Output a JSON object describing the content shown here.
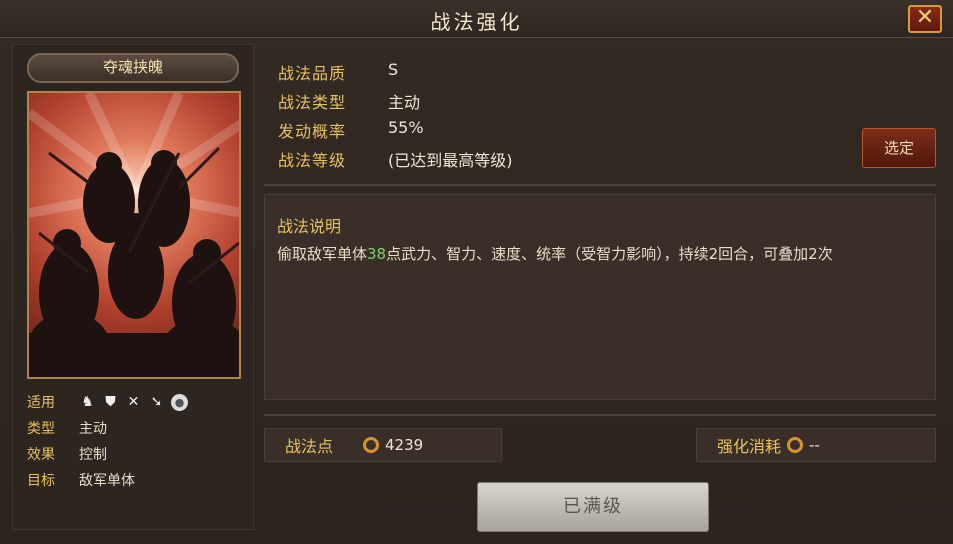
{
  "header": {
    "title": "战法强化",
    "close_label": "✕"
  },
  "skill": {
    "name": "夺魂挟魄",
    "attributes": [
      {
        "key": "适用"
      },
      {
        "key": "类型",
        "value": "主动"
      },
      {
        "key": "效果",
        "value": "控制"
      },
      {
        "key": "目标",
        "value": "敌军单体"
      }
    ],
    "troop_icons": [
      "cavalry-icon",
      "shield-icon",
      "bow-icon",
      "spear-icon",
      "siege-icon"
    ]
  },
  "info": {
    "quality_label": "战法品质",
    "quality_value": "S",
    "type_label": "战法类型",
    "type_value": "主动",
    "rate_label": "发动概率",
    "rate_value": "55%",
    "level_label": "战法等级",
    "level_value": "(已达到最高等级)"
  },
  "confirm_label": "选定",
  "description": {
    "title": "战法说明",
    "text_before": "偷取敌军单体",
    "text_highlight": "38",
    "text_after": "点武力、智力、速度、统率（受智力影响），持续2回合，可叠加2次"
  },
  "points": {
    "label": "战法点",
    "value": "4239"
  },
  "cost": {
    "label": "强化消耗",
    "value": "--"
  },
  "action_button": "已满级",
  "colors": {
    "accent_gold": "#e8c15c",
    "highlight_green": "#7dd069",
    "button_red": "#7d2b17"
  }
}
